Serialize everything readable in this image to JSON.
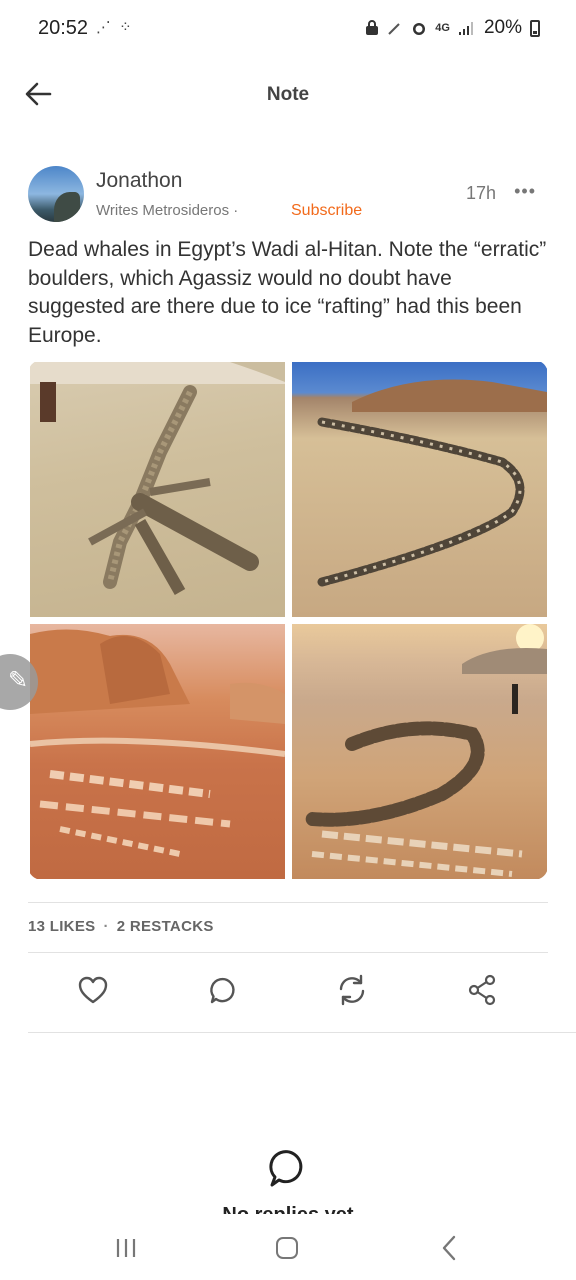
{
  "status_bar": {
    "time": "20:52",
    "left_icons": "⋰ ⁘",
    "network": "4G",
    "battery": "20%"
  },
  "header": {
    "title": "Note"
  },
  "post": {
    "author_name": "Jonathon",
    "author_publication": "Writes Metrosideros ·",
    "subscribe_label": "Subscribe",
    "time": "17h",
    "more": "•••",
    "text": "Dead whales in Egypt’s Wadi al-Hitan. Note the “erratic” boulders, which Agassiz would no doubt have suggested are there due to ice “rafting” had this been Europe."
  },
  "stats": {
    "likes": "13 LIKES",
    "separator": "·",
    "restacks": "2 RESTACKS"
  },
  "icons": {
    "back": "arrow-left-icon",
    "like": "heart-icon",
    "comment": "comment-icon",
    "restack": "restack-icon",
    "share": "share-icon",
    "edit": "pencil-icon"
  },
  "colors": {
    "accent": "#f26a1b",
    "text": "#333333",
    "muted": "#777777"
  },
  "footer": {
    "clipped_text": "No replies yet"
  }
}
